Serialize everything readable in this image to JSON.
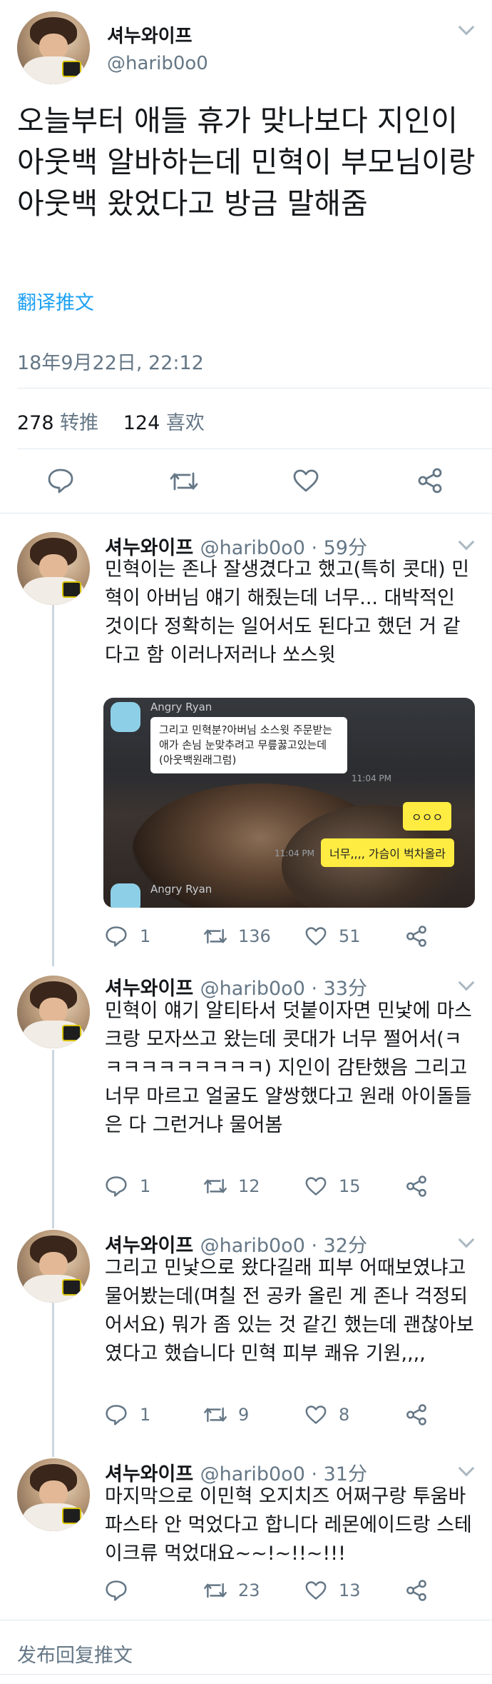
{
  "main": {
    "name": "셔누와이프",
    "handle": "@harib0o0",
    "text": "오늘부터 애들 휴가 맞나보다 지인이 아웃백 알바하는데 민혁이 부모님이랑 아웃백 왔었다고 방금 말해줌",
    "translate_label": "翻译推文",
    "timestamp": "18年9月22日, 22:12",
    "retweets_count": "278",
    "retweets_label": "转推",
    "likes_count": "124",
    "likes_label": "喜欢"
  },
  "replies": [
    {
      "name": "셔누와이프",
      "handle": "@harib0o0 · 59分",
      "text": "민혁이는 존나 잘생겼다고 했고(특히 콧대) 민혁이 아버님 얘기 해줬는데 너무... 대박적인 것이다 정확히는 일어서도 된다고 했던 거 같다고 함 이러나저러나 쏘스윗",
      "reply_count": "1",
      "retweet_count": "136",
      "like_count": "51"
    },
    {
      "name": "셔누와이프",
      "handle": "@harib0o0 · 33分",
      "text": "민혁이 얘기 알티타서 덧붙이자면 민낯에 마스크랑 모자쓰고 왔는데 콧대가 너무 쩔어서(ㅋㅋㅋㅋㅋㅋㅋㅋㅋㅋ) 지인이 감탄했음 그리고 너무 마르고 얼굴도 얄쌍했다고 원래 아이돌들은 다 그런거냐 물어봄",
      "reply_count": "1",
      "retweet_count": "12",
      "like_count": "15"
    },
    {
      "name": "셔누와이프",
      "handle": "@harib0o0 · 32分",
      "text": "그리고 민낯으로 왔다길래 피부 어때보였냐고 물어봤는데(며칠 전 공카 올린 게 존나 걱정되어서요) 뭐가 좀 있는 것 같긴 했는데 괜찮아보였다고 했습니다 민혁 피부 쾌유 기원,,,,",
      "reply_count": "1",
      "retweet_count": "9",
      "like_count": "8"
    },
    {
      "name": "셔누와이프",
      "handle": "@harib0o0 · 31分",
      "text": "마지막으로 이민혁 오지치즈 어쩌구랑 투움바 파스타 안 먹었다고 합니다 레몬에이드랑 스테이크류 먹었대요~~!~!!~!!!",
      "reply_count": "",
      "retweet_count": "23",
      "like_count": "13"
    }
  ],
  "chat_image": {
    "sender_top": "Angry Ryan",
    "message_white": "그리고 민혁분?아버님 소스윗 주문받는애가 손님 눈맞추려고 무릎꿇고있는데(아웃백원래그럼)",
    "time_1": "11:04 PM",
    "message_yellow_1": "ㅇㅇㅇ",
    "time_2": "11:04 PM",
    "message_yellow_2": "너무,,,, 가슴이 벅차올라",
    "sender_bottom": "Angry Ryan"
  },
  "bottom_bar": {
    "label": "发布回复推文"
  },
  "colors": {
    "link_blue": "#1da1f2",
    "secondary_text": "#657786",
    "divider": "#e1e8ed",
    "thread_line": "#ccd6dd"
  }
}
